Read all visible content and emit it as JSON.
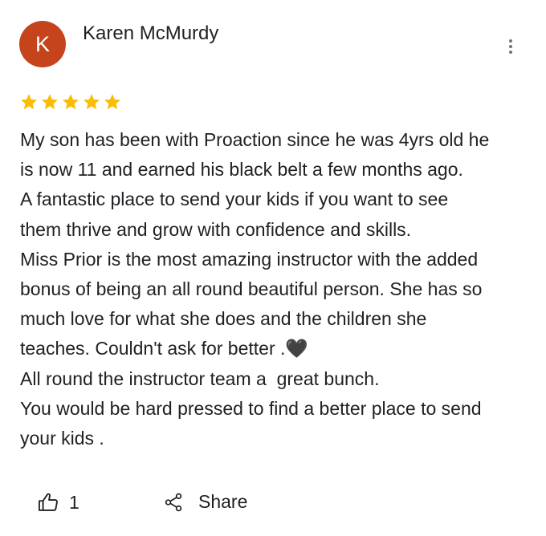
{
  "review": {
    "avatar_initial": "K",
    "avatar_color": "#c5441c",
    "reviewer_name": "Karen McMurdy",
    "rating": 5,
    "rating_max": 5,
    "star_color": "#fbbc04",
    "lines": [
      "My son has been with Proaction since he was 4yrs old he",
      "is now 11 and earned his black belt a few months ago.",
      "A fantastic place to send your kids if you want to see",
      "them thrive and grow with confidence and skills.",
      "Miss Prior is the most amazing instructor with the added",
      "bonus of being an all round beautiful person. She has so",
      "much love for what she does and the children she",
      "teaches. Couldn't ask for better .🖤",
      "All round the instructor team a  great bunch.",
      "You would be hard pressed to find a better place to send",
      "your kids ."
    ]
  },
  "actions": {
    "like_icon": "thumbs-up-icon",
    "like_count": "1",
    "share_icon": "share-icon",
    "share_label": "Share",
    "more_icon": "more-vertical-icon"
  }
}
